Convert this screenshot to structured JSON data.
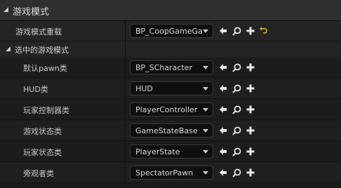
{
  "header": {
    "title": "游戏模式"
  },
  "game_mode_override": {
    "label": "游戏模式重载",
    "value": "BP_CoopGameGam"
  },
  "selected_game_mode": {
    "title": "选中的游戏模式",
    "rows": [
      {
        "label": "默认pawn类",
        "value": "BP_SCharacter"
      },
      {
        "label": "HUD类",
        "value": "HUD"
      },
      {
        "label": "玩家控制器类",
        "value": "PlayerController"
      },
      {
        "label": "游戏状态类",
        "value": "GameStateBase"
      },
      {
        "label": "玩家状态类",
        "value": "PlayerState"
      },
      {
        "label": "旁观者类",
        "value": "SpectatorPawn"
      }
    ]
  },
  "colors": {
    "reset_icon": "#e6c200",
    "icon": "#e8e8e8"
  }
}
